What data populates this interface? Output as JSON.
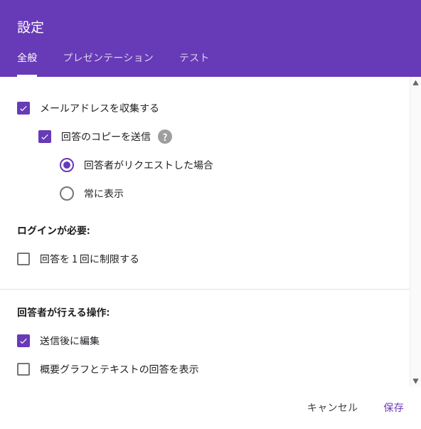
{
  "dialog": {
    "title": "設定",
    "tabs": {
      "general": "全般",
      "presentation": "プレゼンテーション",
      "test": "テスト"
    }
  },
  "options": {
    "collectEmail": "メールアドレスを収集する",
    "sendCopy": "回答のコピーを送信",
    "onRequest": "回答者がリクエストした場合",
    "always": "常に表示"
  },
  "sections": {
    "loginRequired": "ログインが必要:",
    "limitOnce": "回答を 1 回に制限する",
    "respondentActions": "回答者が行える操作:",
    "editAfter": "送信後に編集",
    "showSummary": "概要グラフとテキストの回答を表示"
  },
  "actions": {
    "cancel": "キャンセル",
    "save": "保存"
  }
}
